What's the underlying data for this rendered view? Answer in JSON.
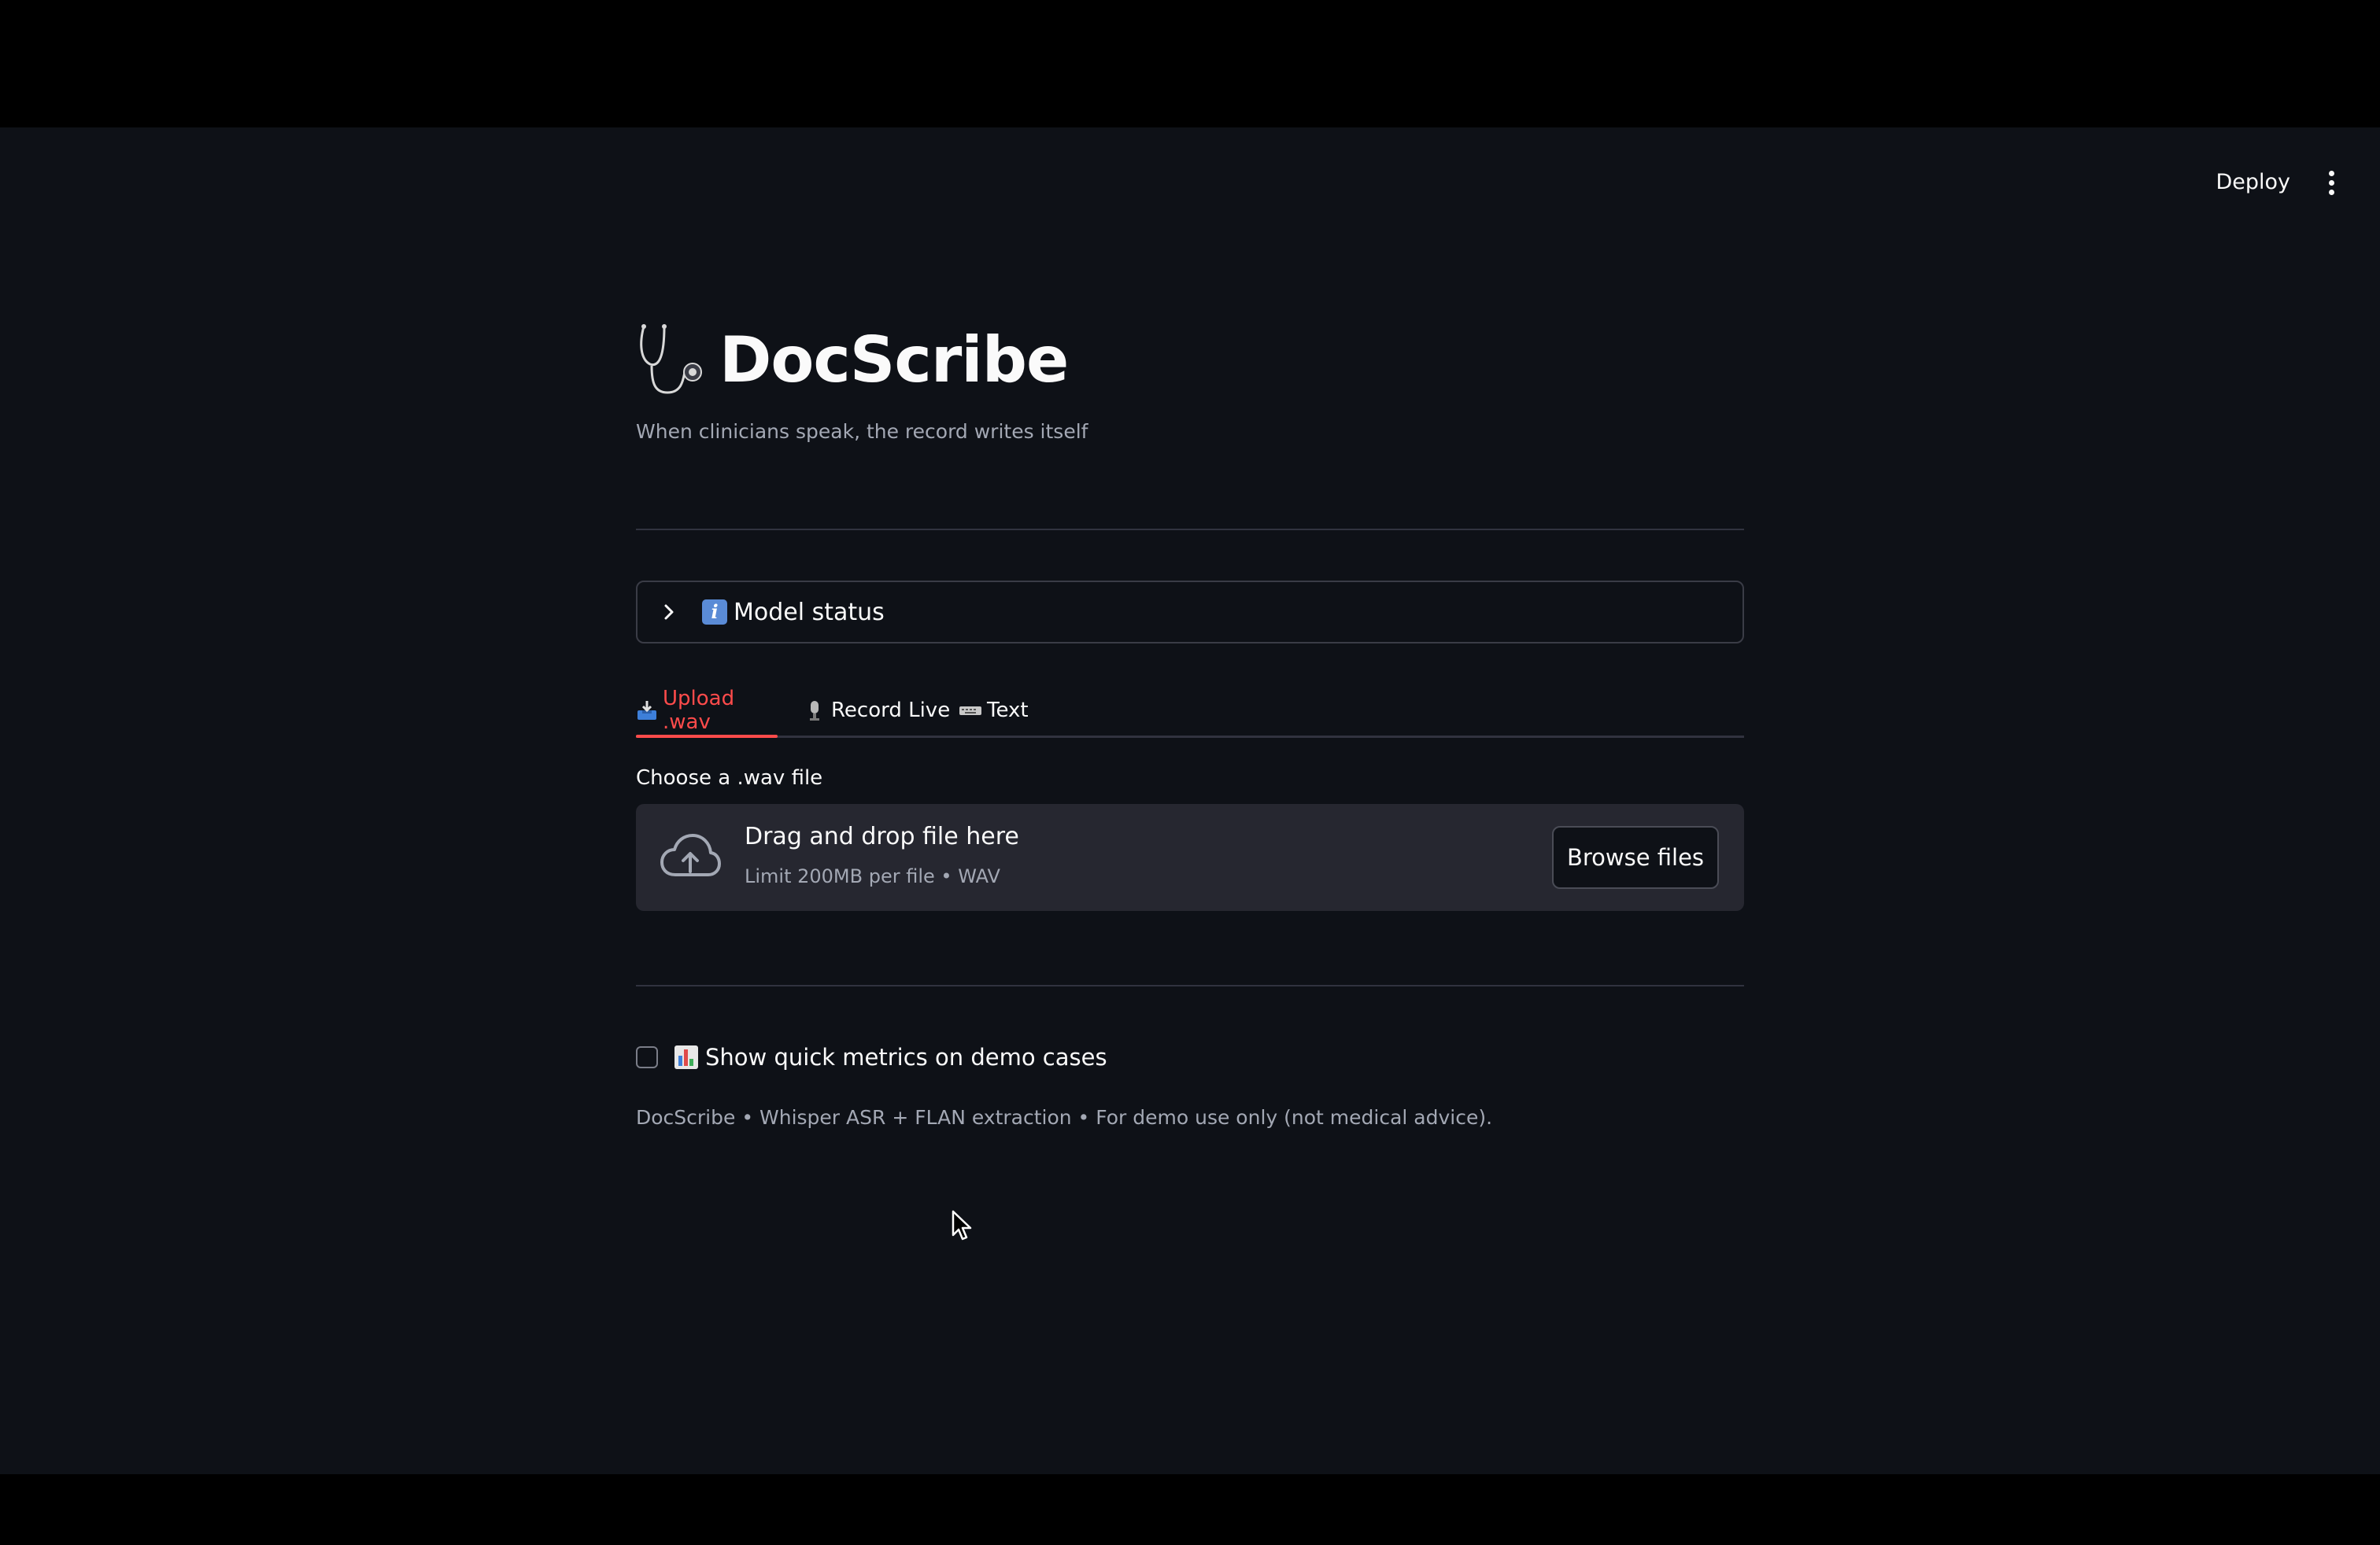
{
  "header": {
    "deploy_label": "Deploy",
    "menu_icon": "kebab-menu-icon"
  },
  "app": {
    "title": "DocScribe",
    "title_icon": "stethoscope-icon",
    "subtitle": "When clinicians speak, the record writes itself"
  },
  "expander": {
    "icon": "info-icon",
    "label": "Model status",
    "expanded": false
  },
  "tabs": [
    {
      "icon": "inbox-tray-icon",
      "label": "Upload .wav",
      "active": true
    },
    {
      "icon": "microphone-icon",
      "label": "Record Live",
      "active": false
    },
    {
      "icon": "keyboard-icon",
      "label": "Text",
      "active": false
    }
  ],
  "uploader": {
    "label": "Choose a .wav file",
    "drop_title": "Drag and drop file here",
    "drop_sub": "Limit 200MB per file • WAV",
    "browse_label": "Browse files"
  },
  "metrics_checkbox": {
    "icon": "bar-chart-icon",
    "label": "Show quick metrics on demo cases",
    "checked": false
  },
  "footer": {
    "text": "DocScribe • Whisper ASR + FLAN extraction • For demo use only (not medical advice)."
  },
  "colors": {
    "background": "#0e1117",
    "accent": "#ff4b4b",
    "text": "#fafafa",
    "muted": "#a3a8b4",
    "dropzone": "#262730"
  }
}
